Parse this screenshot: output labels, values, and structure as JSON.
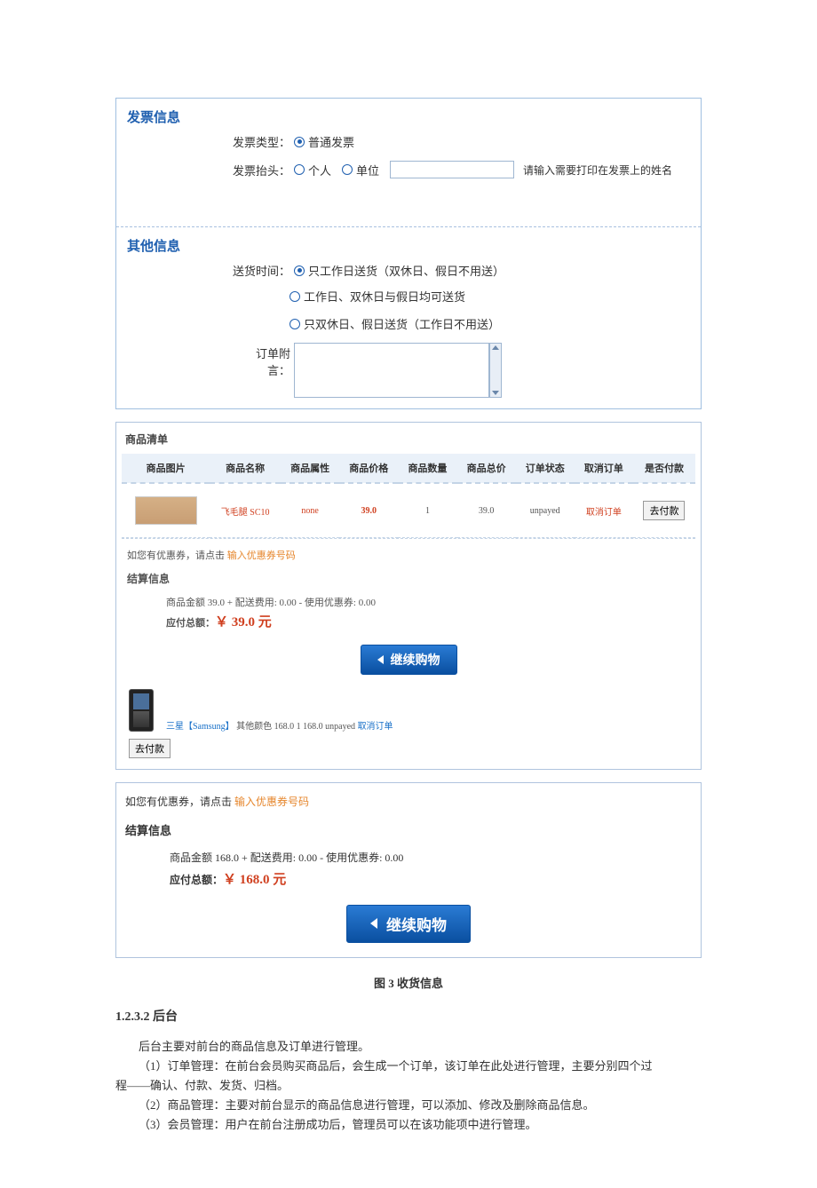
{
  "invoice": {
    "title": "发票信息",
    "type_label": "发票类型：",
    "type_option": "普通发票",
    "head_label": "发票抬头：",
    "head_personal": "个人",
    "head_company": "单位",
    "hint": "请输入需要打印在发票上的姓名"
  },
  "other": {
    "title": "其他信息",
    "ship_label": "送货时间：",
    "opt1": "只工作日送货（双休日、假日不用送）",
    "opt2": "工作日、双休日与假日均可送货",
    "opt3": "只双休日、假日送货（工作日不用送）",
    "notes_label": "订单附言："
  },
  "cart": {
    "title": "商品清单",
    "headers": {
      "img": "商品图片",
      "name": "商品名称",
      "attr": "商品属性",
      "price": "商品价格",
      "qty": "商品数量",
      "total": "商品总价",
      "status": "订单状态",
      "cancel": "取消订单",
      "paid": "是否付款"
    },
    "row1": {
      "name": "飞毛腿 SC10",
      "attr": "none",
      "price": "39.0",
      "qty": "1",
      "total": "39.0",
      "status": "unpayed",
      "cancel": "取消订单",
      "go_pay": "去付款"
    },
    "coupon_prefix": "如您有优惠券，请点击 ",
    "coupon_link": "输入优惠券号码",
    "settle_title": "结算信息",
    "settle_line": "商品金额 39.0 + 配送费用: 0.00 - 使用优惠券: 0.00",
    "pay_label": "应付总额：",
    "pay_amount": "￥ 39.0 元",
    "continue": "继续购物",
    "row2": {
      "brand": "三星【Samsung】",
      "rest": " 其他颜色 168.0 1 168.0 unpayed ",
      "cancel": "取消订单",
      "go_pay": "去付款"
    }
  },
  "settle2": {
    "coupon_prefix": "如您有优惠券，请点击 ",
    "coupon_link": "输入优惠券号码",
    "title": "结算信息",
    "line": "商品金额 168.0 + 配送费用: 0.00 - 使用优惠券: 0.00",
    "pay_label": "应付总额：",
    "pay_amount": "￥ 168.0 元",
    "continue": "继续购物"
  },
  "caption": "图 3 收货信息",
  "sec": {
    "num": "1.2.3.2 后台",
    "p1": "后台主要对前台的商品信息及订单进行管理。",
    "p2": "（1）订单管理：在前台会员购买商品后，会生成一个订单，该订单在此处进行管理，主要分别四个过",
    "p2b": "程——确认、付款、发货、归档。",
    "p3": "（2）商品管理：主要对前台显示的商品信息进行管理，可以添加、修改及删除商品信息。",
    "p4": "（3）会员管理：用户在前台注册成功后，管理员可以在该功能项中进行管理。"
  }
}
